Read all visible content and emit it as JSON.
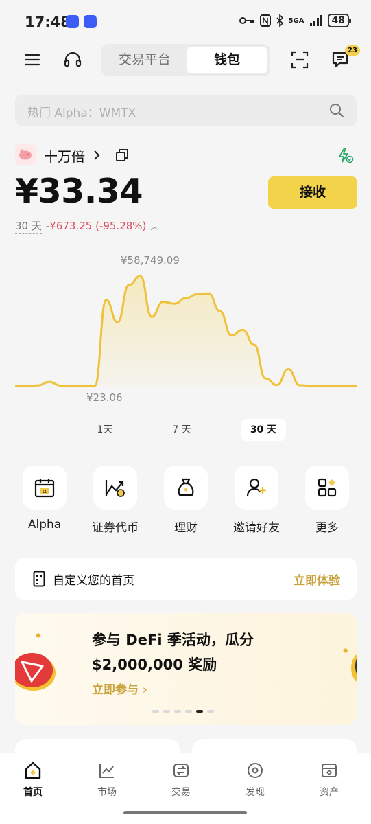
{
  "status_bar": {
    "time": "17:48",
    "network": "5GA",
    "battery": "48"
  },
  "top_nav": {
    "tabs": [
      "交易平台",
      "钱包"
    ],
    "active_tab": "钱包",
    "message_badge": "23"
  },
  "search": {
    "placeholder": "热门 Alpha：WMTX"
  },
  "account": {
    "name": "十万倍",
    "balance": "¥33.34",
    "receive_label": "接收",
    "period": "30 天",
    "change": "-¥673.25 (-95.28%)"
  },
  "chart_data": {
    "type": "area",
    "max_label": "¥58,749.09",
    "min_label": "¥23.06",
    "values": [
      23.06,
      40,
      300,
      2200,
      200,
      23.06,
      23.06,
      23.06,
      46000,
      34000,
      54000,
      58749.09,
      37000,
      45000,
      44000,
      47000,
      49000,
      49500,
      40000,
      27000,
      30000,
      22000,
      4000,
      500,
      9000,
      400,
      100,
      80,
      60,
      50,
      40
    ]
  },
  "ranges": {
    "items": [
      "1天",
      "7 天",
      "30 天"
    ],
    "active": "30 天"
  },
  "quick_actions": [
    {
      "label": "Alpha",
      "icon": "alpha-calendar-icon"
    },
    {
      "label": "证券代币",
      "icon": "stock-chart-icon"
    },
    {
      "label": "理财",
      "icon": "money-bag-icon"
    },
    {
      "label": "邀请好友",
      "icon": "invite-user-icon"
    },
    {
      "label": "更多",
      "icon": "more-grid-icon"
    }
  ],
  "customize": {
    "text": "自定义您的首页",
    "link": "立即体验"
  },
  "banner": {
    "line1": "参与 DeFi 季活动，瓜分",
    "line2": "$2,000,000 奖励",
    "link": "立即参与 ›"
  },
  "tab_bar": {
    "items": [
      "首页",
      "市场",
      "交易",
      "发现",
      "资产"
    ],
    "active": "首页"
  },
  "colors": {
    "accent": "#f3d34a",
    "negative": "#d9485a",
    "chart_line": "#f0c23c",
    "link": "#c9a23a"
  }
}
